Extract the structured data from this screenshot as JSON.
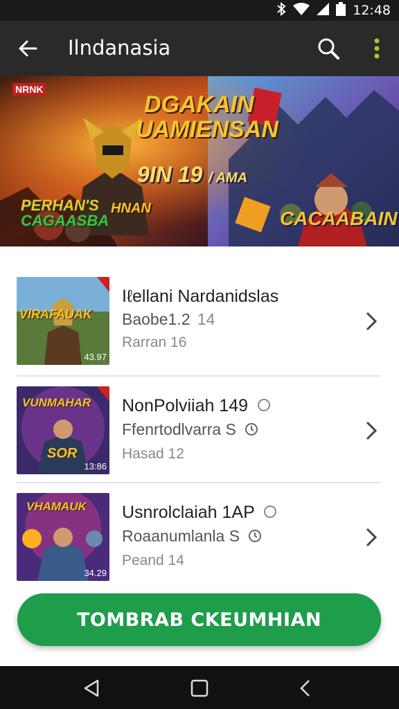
{
  "status_bar": {
    "time": "12:48",
    "icons": [
      "bluetooth-icon",
      "wifi-icon",
      "signal-icon",
      "battery-icon"
    ]
  },
  "app_bar": {
    "title": "Ilndanasia",
    "back_icon": "back-arrow-icon",
    "search_icon": "search-icon",
    "menu_icon": "more-vert-icon"
  },
  "banner": {
    "corner_tag": "NRNK",
    "headline_1": "DGAKAIN",
    "headline_2": "UAMIENSAN",
    "date": "9IN 19",
    "date_suffix": "/ AMA",
    "left_badge_1": "PERHAN'S",
    "left_badge_2": "CAGAASBA",
    "center_badge": "HNAN",
    "right_badge": "CACAABAIN"
  },
  "items": [
    {
      "title": "Iℓellani Nardanidslas",
      "subtitle": "Baobe1.2",
      "subtitle_suffix": "14",
      "meta": "Rarran 16",
      "thumb_title": "VIRAFAUAK",
      "thumb_corner": "43.97"
    },
    {
      "title": "NonPolviiah 149",
      "subtitle": "Ffenrtodlvarra S",
      "meta": "Hasad 12",
      "thumb_title": "VUNMAHAR",
      "thumb_badge": "SOR",
      "thumb_corner": "13:86"
    },
    {
      "title": "Usnrolclaiah 1AP",
      "subtitle": "Roaanumlanla S",
      "meta": "Peand 14",
      "thumb_title": "VHAMAUK",
      "thumb_corner": "34.29"
    }
  ],
  "cta": {
    "label": "TOMBRAB CKEUMHIAN"
  },
  "nav": {
    "back_icon": "nav-back-triangle-icon",
    "home_icon": "nav-home-square-icon",
    "recent_icon": "nav-recent-chevron-icon"
  },
  "colors": {
    "accent": "#1e9d4b",
    "app_bar": "#2a2a2a",
    "status_bar": "#1a1a1a",
    "nav_bar": "#111111"
  }
}
